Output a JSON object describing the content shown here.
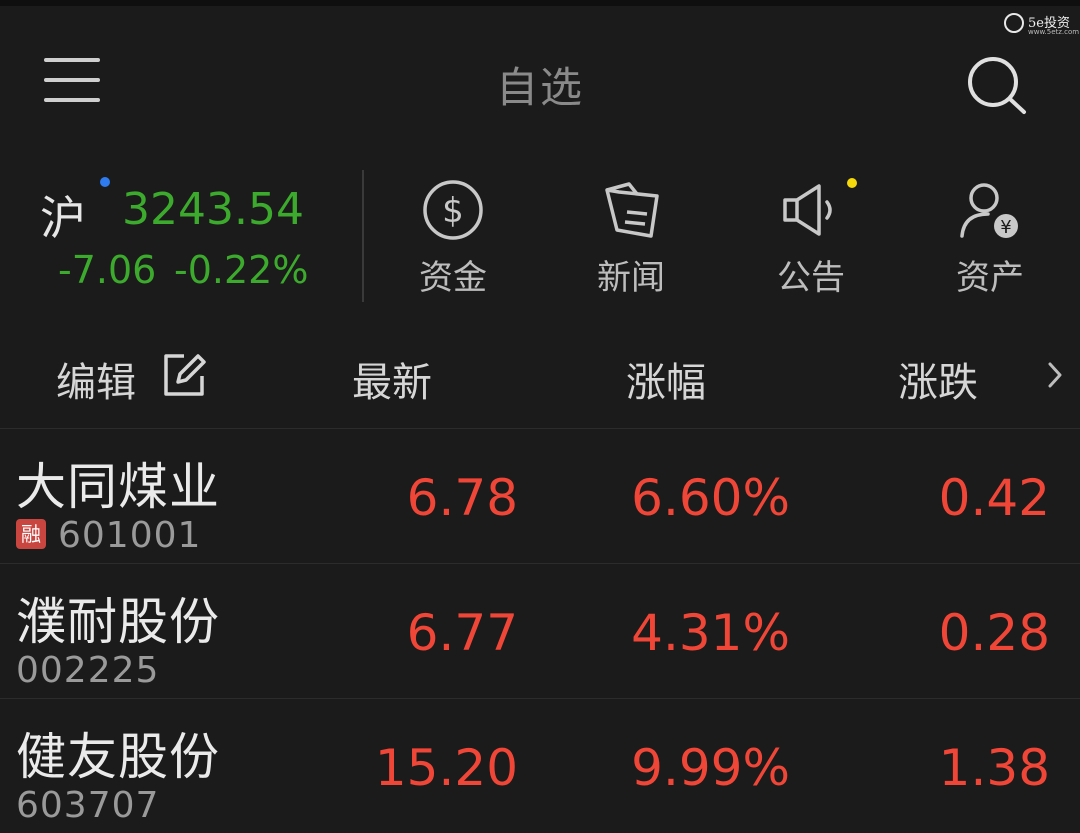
{
  "header": {
    "title": "自选",
    "watermark_text": "5e投资",
    "watermark_url": "www.5etz.com"
  },
  "index": {
    "name": "沪",
    "value": "3243.54",
    "change": "-7.06",
    "change_pct": "-0.22%",
    "color": "#3caa2c"
  },
  "quick_links": [
    {
      "label": "资金",
      "icon": "dollar-circle-icon"
    },
    {
      "label": "新闻",
      "icon": "news-icon"
    },
    {
      "label": "公告",
      "icon": "megaphone-icon"
    },
    {
      "label": "资产",
      "icon": "user-yuan-icon"
    }
  ],
  "table": {
    "columns": {
      "edit": "编辑",
      "latest": "最新",
      "change_pct": "涨幅",
      "change": "涨跌"
    },
    "rows": [
      {
        "name": "大同煤业",
        "code": "601001",
        "badge": "融",
        "latest": "6.78",
        "change_pct": "6.60%",
        "change": "0.42"
      },
      {
        "name": "濮耐股份",
        "code": "002225",
        "badge": "",
        "latest": "6.77",
        "change_pct": "4.31%",
        "change": "0.28"
      },
      {
        "name": "健友股份",
        "code": "603707",
        "badge": "",
        "latest": "15.20",
        "change_pct": "9.99%",
        "change": "1.38"
      }
    ]
  },
  "colors": {
    "up": "#f04637",
    "down": "#3caa2c",
    "background": "#1b1b1b",
    "notification_blue": "#2f7cf0",
    "notification_yellow": "#f5d90a"
  }
}
